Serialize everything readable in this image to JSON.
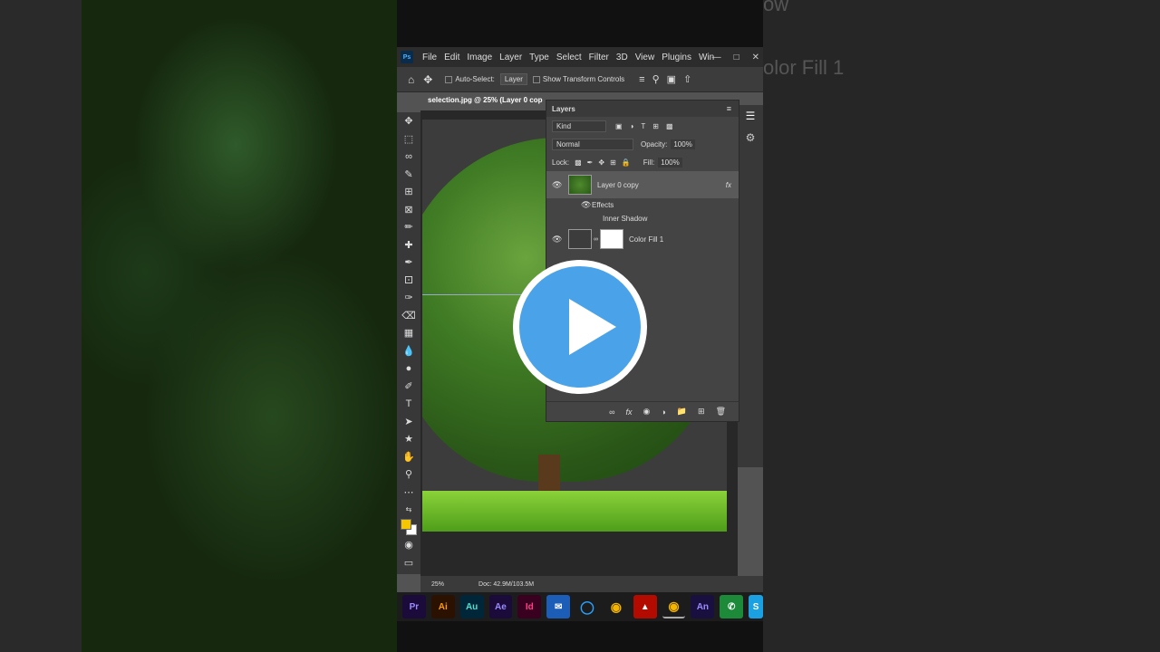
{
  "menu": {
    "app_badge": "Ps",
    "items": [
      "File",
      "Edit",
      "Image",
      "Layer",
      "Type",
      "Select",
      "Filter",
      "3D",
      "View",
      "Plugins",
      "Win"
    ]
  },
  "options": {
    "auto_select_label": "Auto-Select:",
    "auto_select_value": "Layer",
    "transform_label": "Show Transform Controls"
  },
  "document": {
    "tab_title": "selection.jpg @ 25% (Layer 0 cop",
    "zoom": "25%",
    "doc_size": "Doc: 42.9M/103.5M"
  },
  "layers_panel": {
    "title": "Layers",
    "filter_kind": "Kind",
    "blend_mode": "Normal",
    "opacity_label": "Opacity:",
    "opacity_value": "100%",
    "lock_label": "Lock:",
    "fill_label": "Fill:",
    "fill_value": "100%",
    "layers": [
      {
        "name": "Layer 0 copy",
        "fx": "fx"
      },
      {
        "name": "Color Fill 1"
      }
    ],
    "effects_label": "Effects",
    "effect_item": "Inner Shadow"
  },
  "taskbar": [
    "Pr",
    "Ai",
    "Au",
    "Ae",
    "Id",
    "An",
    "S"
  ],
  "background": {
    "ghost_right_1": "ow",
    "ghost_right_2": "olor Fill 1"
  },
  "colors": {
    "accent": "#4aa3e8",
    "ps_blue": "#4fb1ff"
  }
}
